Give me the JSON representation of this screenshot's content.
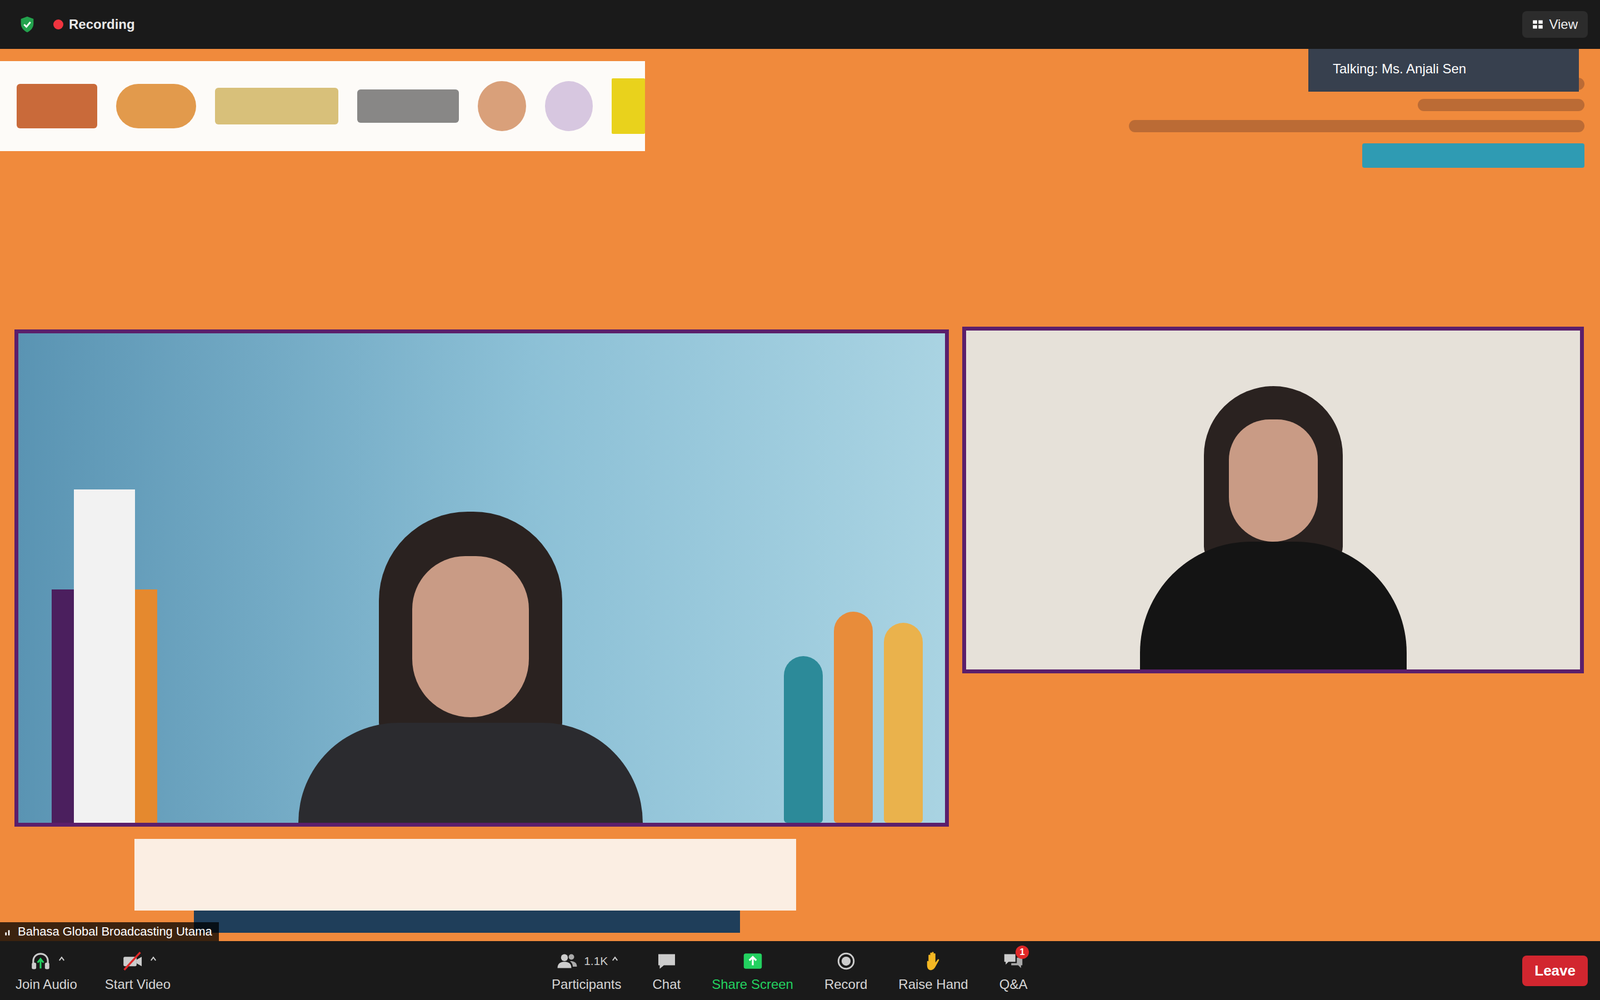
{
  "top_bar": {
    "recording": {
      "label": "Recording",
      "on": true
    },
    "view_button": {
      "label": "View"
    }
  },
  "talking_indicator": {
    "label": "Talking: Ms. Anjali Sen"
  },
  "video": {
    "name_label": "Bahasa Global Broadcasting Utama"
  },
  "toolbar": {
    "left": [
      {
        "kind": "audio",
        "label": "Join Audio",
        "has_menu": true,
        "muted": false
      },
      {
        "kind": "video",
        "label": "Start Video",
        "has_menu": true,
        "muted": true
      }
    ],
    "center": [
      {
        "kind": "participants",
        "label": "Participants",
        "count": "1.1K",
        "badge": "",
        "has_menu": true,
        "highlighted": false
      },
      {
        "kind": "chat",
        "label": "Chat",
        "count": "",
        "badge": "",
        "has_menu": false,
        "highlighted": false
      },
      {
        "kind": "share",
        "label": "Share Screen",
        "count": "",
        "badge": "",
        "has_menu": false,
        "highlighted": true
      },
      {
        "kind": "record",
        "label": "Record",
        "count": "",
        "badge": "",
        "has_menu": false,
        "highlighted": false
      },
      {
        "kind": "hand",
        "label": "Raise Hand",
        "count": "",
        "badge": "",
        "has_menu": false,
        "highlighted": false
      },
      {
        "kind": "qa",
        "label": "Q&A",
        "count": "",
        "badge": "1",
        "has_menu": false,
        "highlighted": false
      }
    ],
    "leave": {
      "label": "Leave"
    }
  }
}
